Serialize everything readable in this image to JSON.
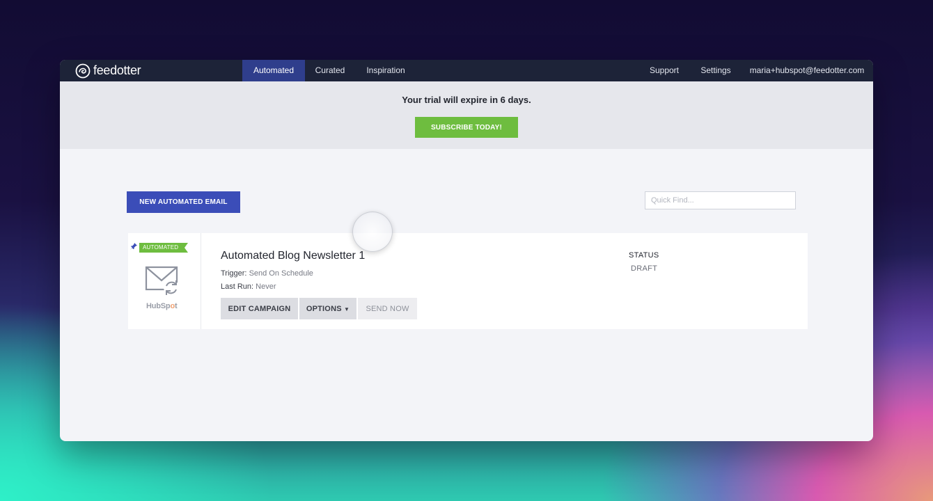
{
  "app": {
    "logo_text": "feedotter"
  },
  "nav": {
    "tabs": [
      {
        "label": "Automated",
        "active": true
      },
      {
        "label": "Curated",
        "active": false
      },
      {
        "label": "Inspiration",
        "active": false
      }
    ],
    "right": {
      "support": "Support",
      "settings": "Settings",
      "account": "maria+hubspot@feedotter.com"
    }
  },
  "trial": {
    "message": "Your trial will expire in 6 days.",
    "subscribe_label": "SUBSCRIBE TODAY!"
  },
  "toolbar": {
    "new_label": "NEW AUTOMATED EMAIL",
    "search_placeholder": "Quick Find..."
  },
  "campaign": {
    "badge": "AUTOMATED",
    "integration": "HubSpot",
    "title": "Automated Blog Newsletter 1",
    "trigger_label": "Trigger:",
    "trigger_value": "Send On Schedule",
    "last_run_label": "Last Run:",
    "last_run_value": "Never",
    "actions": {
      "edit": "EDIT CAMPAIGN",
      "options": "OPTIONS",
      "send": "SEND NOW"
    },
    "status_label": "STATUS",
    "status_value": "DRAFT"
  },
  "colors": {
    "topbar": "#1d2338",
    "active_tab": "#2f3e8c",
    "subscribe": "#6ebd3f",
    "primary_button": "#3b4db8",
    "badge": "#6ebd3f"
  }
}
